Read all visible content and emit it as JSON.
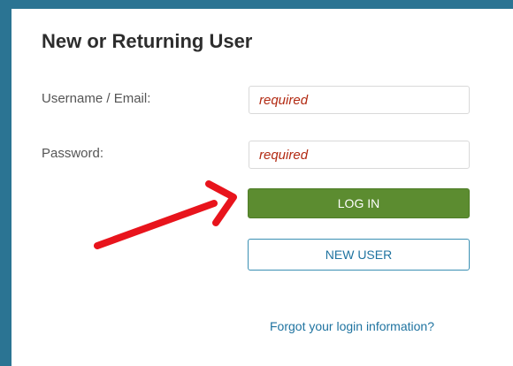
{
  "form": {
    "title": "New or Returning User",
    "username_label": "Username / Email:",
    "username_placeholder": "required",
    "password_label": "Password:",
    "password_placeholder": "required",
    "login_button": "LOG IN",
    "new_user_button": "NEW USER",
    "forgot_link": "Forgot your login information?"
  },
  "colors": {
    "background": "#2b7493",
    "login_button": "#5c8c30",
    "placeholder": "#b22a12",
    "link": "#1f73a0",
    "arrow": "#e8141c"
  },
  "annotation": {
    "icon": "red-arrow-icon"
  }
}
